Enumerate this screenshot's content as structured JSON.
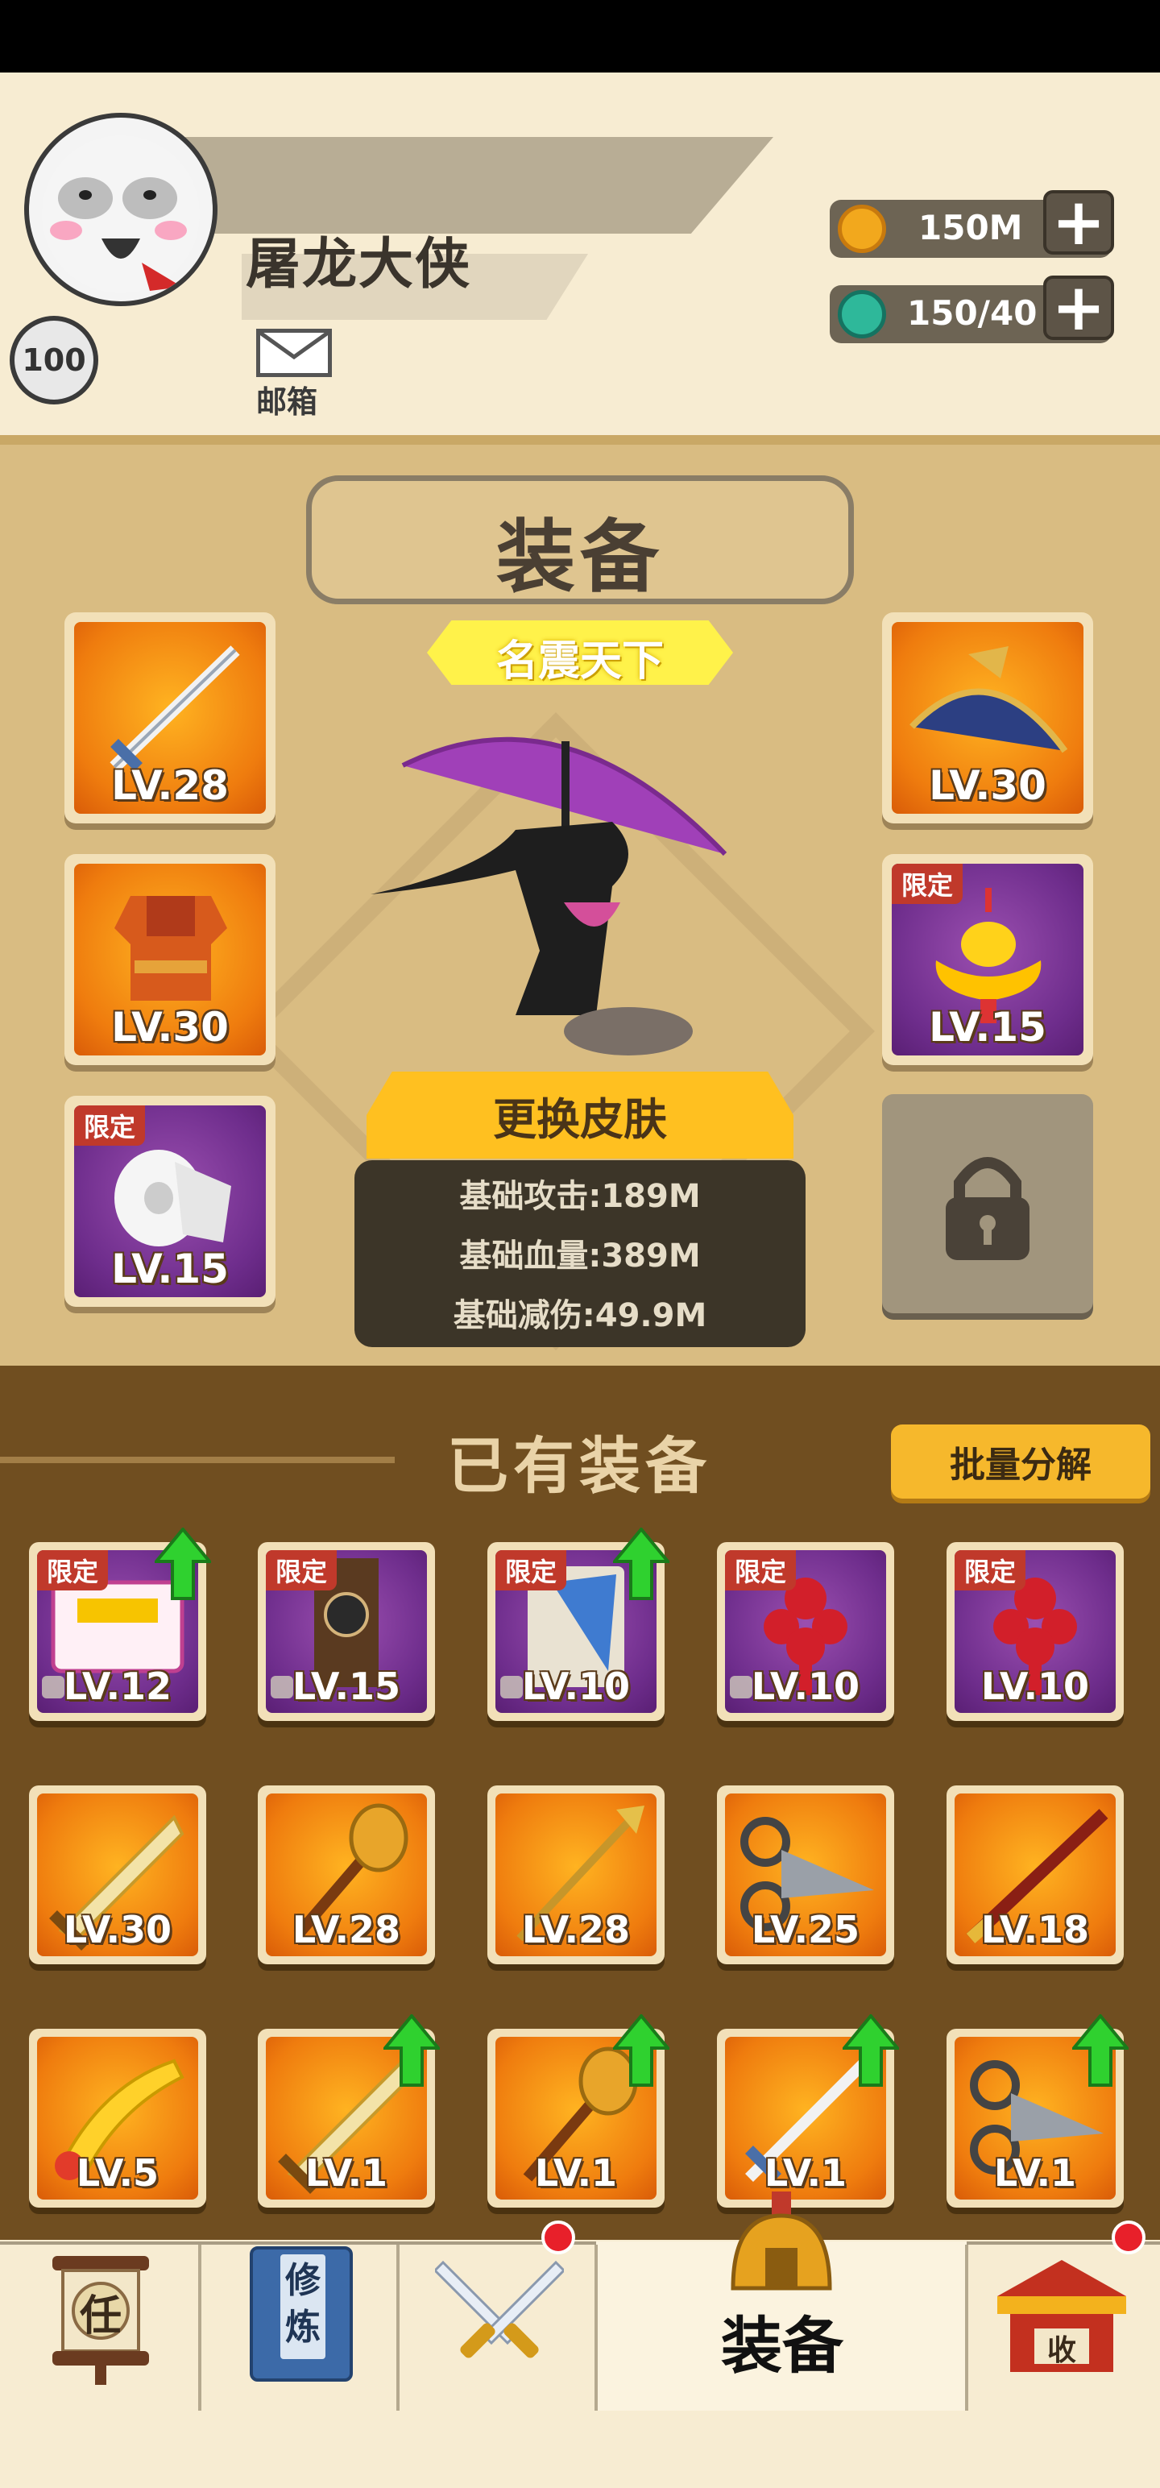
{
  "header": {
    "player_name": "屠龙大侠",
    "player_level": "100",
    "mail_label": "邮箱",
    "resources": [
      {
        "icon": "gold-coin-icon",
        "value": "150M"
      },
      {
        "icon": "jade-drop-icon",
        "value": "150/40"
      }
    ]
  },
  "equipment": {
    "title": "装备",
    "rank_title": "名震天下",
    "left_slots": [
      {
        "icon": "sword-icon",
        "level": "LV.28",
        "limited": false
      },
      {
        "icon": "armor-icon",
        "level": "LV.30",
        "limited": false
      },
      {
        "icon": "toilet-paper-icon",
        "level": "LV.15",
        "limited": true
      }
    ],
    "right_slots": [
      {
        "icon": "bamboo-hat-icon",
        "level": "LV.30",
        "limited": false
      },
      {
        "icon": "gold-ingot-icon",
        "level": "LV.15",
        "limited": true
      },
      {
        "icon": "lock-icon",
        "level": "",
        "limited": false
      }
    ],
    "limited_tag": "限定",
    "change_skin_label": "更换皮肤",
    "stats": [
      {
        "label": "基础攻击",
        "value": "189M"
      },
      {
        "label": "基础血量",
        "value": "389M"
      },
      {
        "label": "基础减伤",
        "value": "49.9M"
      }
    ]
  },
  "owned": {
    "title": "已有装备",
    "batch_label": "批量分解",
    "rows": [
      [
        {
          "icon": "comic-book-icon",
          "level": "LV.12",
          "limited": true,
          "upgrade": true,
          "locked": true
        },
        {
          "icon": "banner-flag-icon",
          "level": "LV.15",
          "limited": true,
          "upgrade": false,
          "locked": true
        },
        {
          "icon": "scroll-book-icon",
          "level": "LV.10",
          "limited": true,
          "upgrade": true,
          "locked": true
        },
        {
          "icon": "chinese-knot-icon",
          "level": "LV.10",
          "limited": true,
          "upgrade": false,
          "locked": true
        },
        {
          "icon": "chinese-knot-icon",
          "level": "LV.10",
          "limited": true,
          "upgrade": false,
          "locked": false
        }
      ],
      [
        {
          "icon": "broadsword-icon",
          "level": "LV.30",
          "limited": false,
          "upgrade": false,
          "locked": false
        },
        {
          "icon": "mace-icon",
          "level": "LV.28",
          "limited": false,
          "upgrade": false,
          "locked": false
        },
        {
          "icon": "trident-spear-icon",
          "level": "LV.28",
          "limited": false,
          "upgrade": false,
          "locked": false
        },
        {
          "icon": "scissors-icon",
          "level": "LV.25",
          "limited": false,
          "upgrade": false,
          "locked": false
        },
        {
          "icon": "staff-icon",
          "level": "LV.18",
          "limited": false,
          "upgrade": false,
          "locked": false
        }
      ],
      [
        {
          "icon": "rubber-chicken-icon",
          "level": "LV.5",
          "limited": false,
          "upgrade": false,
          "locked": false
        },
        {
          "icon": "broadsword-icon",
          "level": "LV.1",
          "limited": false,
          "upgrade": true,
          "locked": false
        },
        {
          "icon": "mace-icon",
          "level": "LV.1",
          "limited": false,
          "upgrade": true,
          "locked": false
        },
        {
          "icon": "sword-icon",
          "level": "LV.1",
          "limited": false,
          "upgrade": true,
          "locked": false
        },
        {
          "icon": "scissors-icon",
          "level": "LV.1",
          "limited": false,
          "upgrade": true,
          "locked": false
        }
      ]
    ]
  },
  "nav": {
    "task_glyph": "任",
    "cultivate_glyphs": "修炼",
    "equip_label": "装备",
    "shop_glyph": "收"
  }
}
